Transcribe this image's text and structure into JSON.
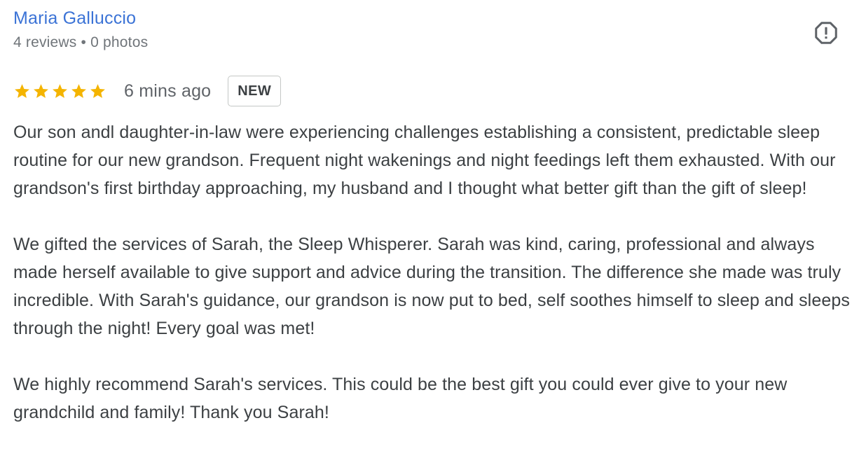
{
  "reviewer": {
    "name": "Maria Galluccio",
    "meta": "4 reviews • 0 photos"
  },
  "report": {
    "icon": "report-flag-icon"
  },
  "rating": {
    "stars": 5,
    "max_stars": 5,
    "star_color": "#f4b400",
    "time_ago": "6 mins ago",
    "badge": "NEW"
  },
  "review": {
    "paragraphs": [
      "Our son andl daughter-in-law were experiencing challenges establishing a consistent, predictable sleep routine for our new grandson. Frequent night wakenings and night feedings left them exhausted. With our grandson's first birthday approaching, my husband and I thought what better gift than the gift of sleep!",
      "We gifted the services of Sarah, the Sleep Whisperer. Sarah was kind, caring, professional and always made herself available to give support and advice during the transition. The difference she made was truly incredible. With Sarah's guidance, our grandson is now put to bed, self soothes himself to sleep and sleeps through the night! Every goal was met!",
      "We highly recommend Sarah's services. This could be the best gift you could ever give to your new grandchild and family! Thank you Sarah!"
    ]
  },
  "colors": {
    "name_link": "#3b73d6",
    "meta_text": "#70757a",
    "body_text": "#3c4043"
  }
}
